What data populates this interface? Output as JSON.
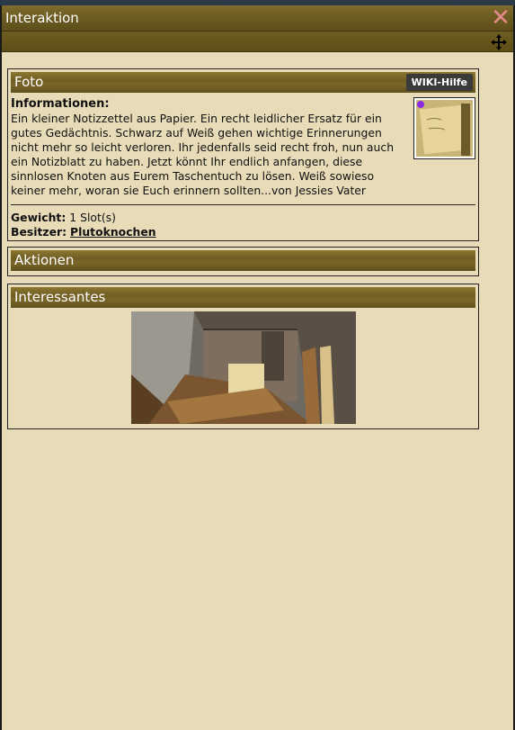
{
  "window": {
    "title": "Interaktion"
  },
  "foto": {
    "header": "Foto",
    "wiki_label": "WIKI-Hilfe",
    "info_heading": "Informationen:",
    "info_text": "Ein kleiner Notizzettel aus Papier. Ein recht leidlicher Ersatz für ein gutes Gedächtnis. Schwarz auf Weiß gehen wichtige Erinnerungen nicht mehr so leicht verloren. Ihr jedenfalls seid recht froh, nun auch ein Notizblatt zu haben. Jetzt könnt Ihr endlich anfangen, diese sinnlosen Knoten aus Eurem Taschentuch zu lösen. Weiß sowieso keiner mehr, woran sie Euch erinnern sollten...von Jessies Vater",
    "weight_label": "Gewicht:",
    "weight_value": "1 Slot(s)",
    "owner_label": "Besitzer:",
    "owner_value": "Plutoknochen"
  },
  "aktionen": {
    "header": "Aktionen"
  },
  "interessantes": {
    "header": "Interessantes"
  },
  "icons": {
    "close": "close-icon",
    "move": "move-icon"
  },
  "colors": {
    "header_gold": "#6d5c22",
    "background": "#e8dbb8",
    "close_red": "#e58a8a"
  }
}
